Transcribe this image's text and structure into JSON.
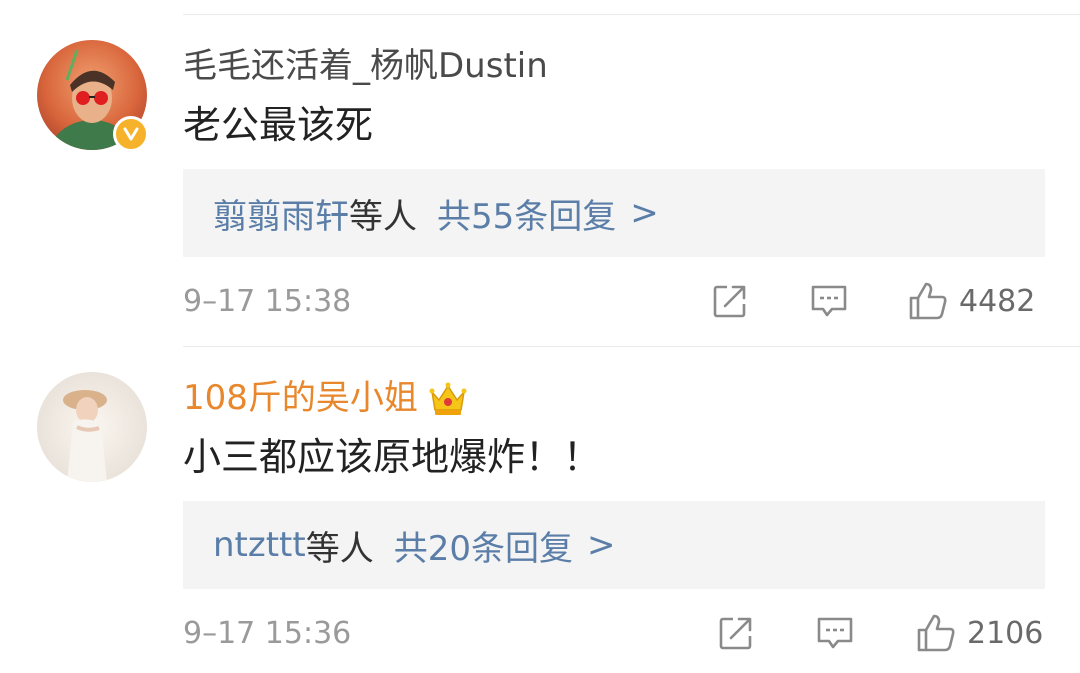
{
  "comments": [
    {
      "username": "毛毛还活着_杨帆Dustin",
      "verified": true,
      "text": "老公最该死",
      "reply_names": "翦翦雨轩",
      "reply_suffix": "等人",
      "reply_count": "共55条回复",
      "reply_chevron": ">",
      "timestamp": "9–17 15:38",
      "likes": "4482"
    },
    {
      "username": "108斤的吴小姐",
      "vip": true,
      "text": "小三都应该原地爆炸！！",
      "reply_names": "ntzttt",
      "reply_suffix": "等人",
      "reply_count": "共20条回复",
      "reply_chevron": ">",
      "timestamp": "9–17 15:36",
      "likes": "2106"
    }
  ],
  "icons": {
    "share": "share-icon",
    "comment": "comment-icon",
    "like": "thumbs-up-icon",
    "verified": "verified-badge-icon",
    "vip": "crown-icon"
  },
  "colors": {
    "link": "#5b7ea8",
    "vip_name": "#e8872b",
    "reply_bg": "#f4f4f4",
    "verified_badge": "#f6b22b"
  }
}
